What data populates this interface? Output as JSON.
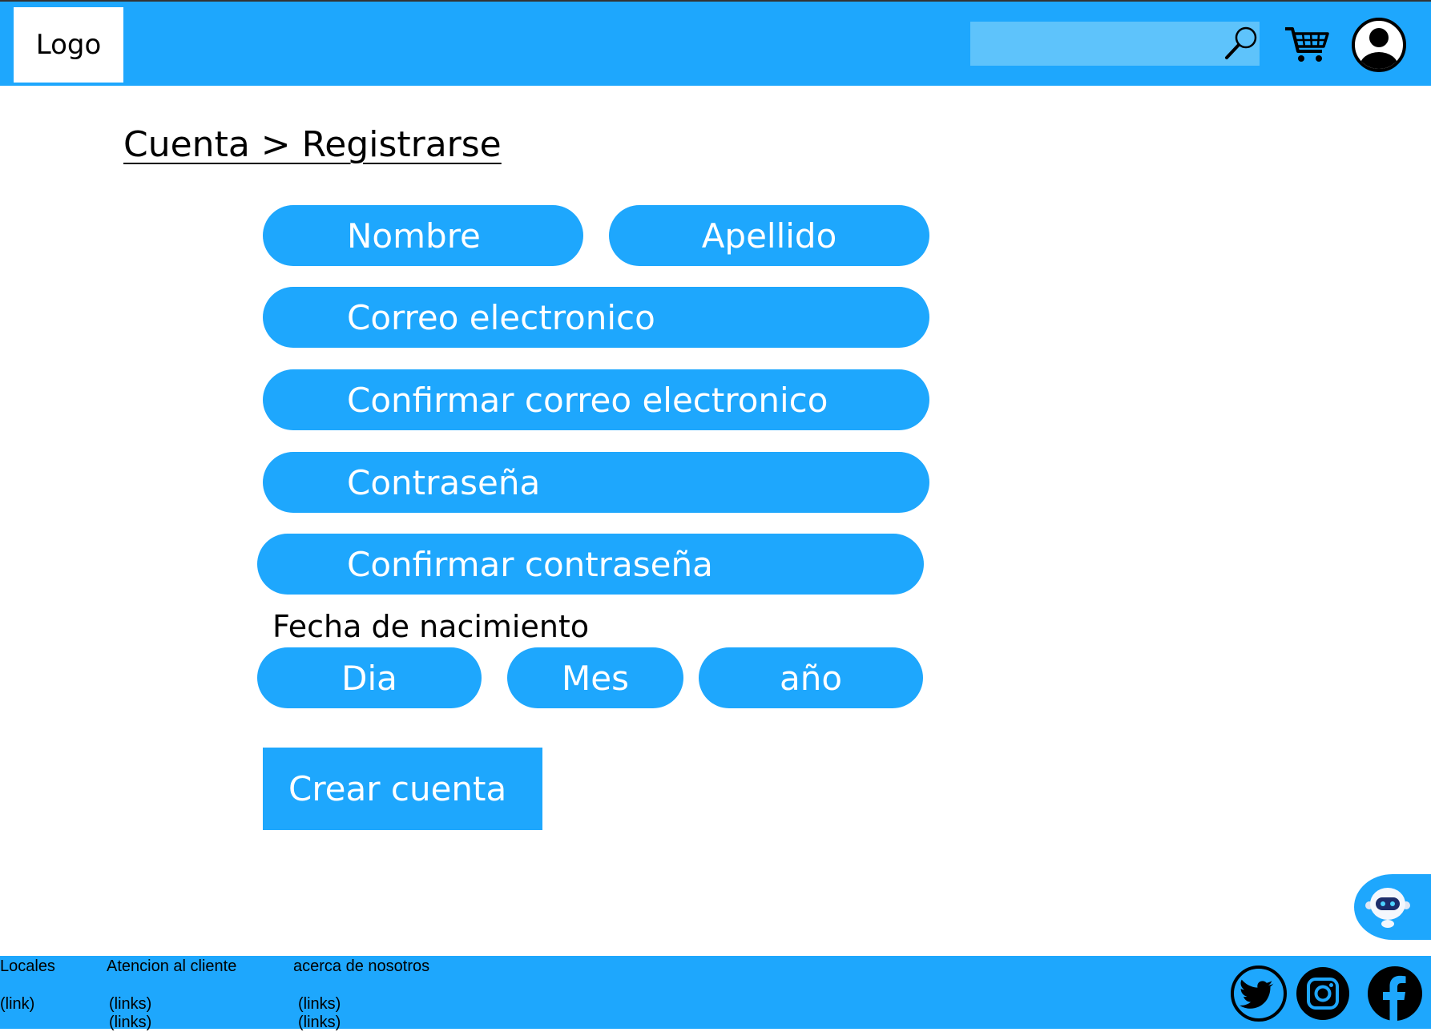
{
  "header": {
    "logo_text": "Logo",
    "search": {
      "value": "",
      "placeholder": ""
    },
    "icons": [
      "search-icon",
      "cart-icon",
      "user-account-icon"
    ],
    "accent_color": "#1ea7fd"
  },
  "breadcrumb": "Cuenta > Registrarse",
  "form": {
    "nombre": "Nombre",
    "apellido": "Apellido",
    "correo": "Correo electronico",
    "confirmar_correo": "Confirmar correo electronico",
    "contrasena": "Contraseña",
    "confirmar_contrasena": "Confirmar contraseña",
    "fecha_label": "Fecha de nacimiento",
    "dia": "Dia",
    "mes": "Mes",
    "anio": "año",
    "submit": "Crear cuenta"
  },
  "chatbot": {
    "icon": "robot-assistant-icon"
  },
  "footer": {
    "col1": {
      "title": "Locales",
      "links": [
        "(link)"
      ]
    },
    "col2": {
      "title": "Atencion al cliente",
      "links": [
        "(links)",
        "(links)"
      ]
    },
    "col3": {
      "title": "acerca de nosotros",
      "links": [
        "(links)",
        "(links)"
      ]
    },
    "social": [
      "twitter-icon",
      "instagram-icon",
      "facebook-icon"
    ]
  }
}
